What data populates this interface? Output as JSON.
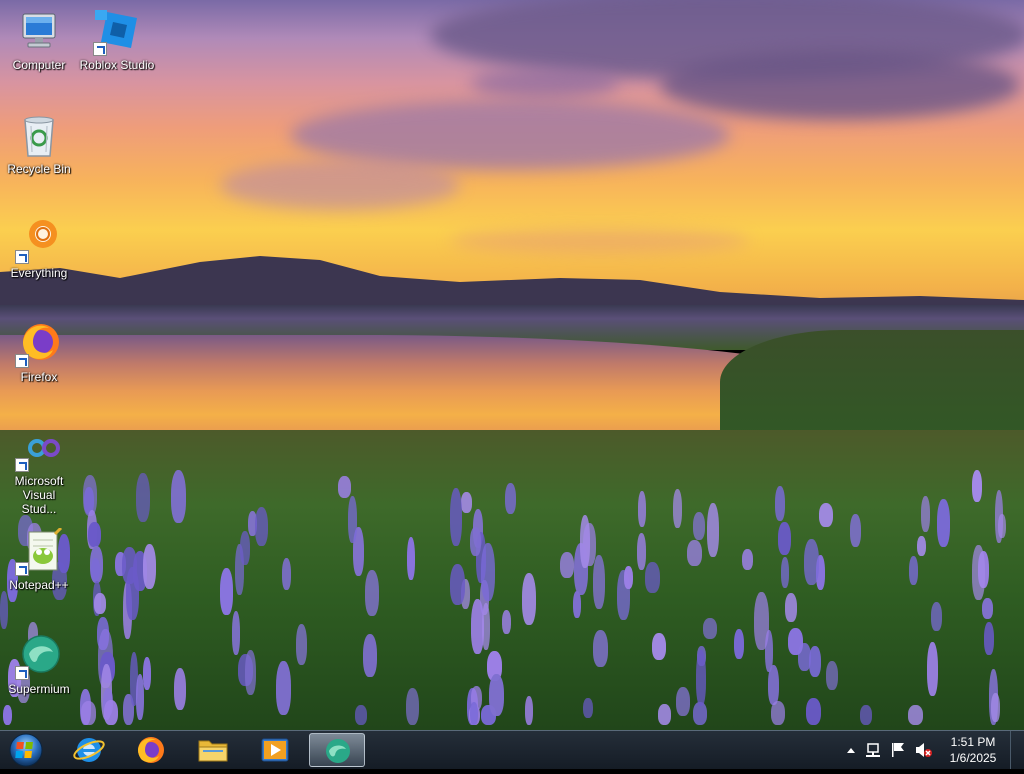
{
  "desktop": {
    "icons": [
      {
        "label": "Computer",
        "icon": "computer-icon"
      },
      {
        "label": "Roblox Studio",
        "icon": "roblox-studio-icon"
      },
      {
        "label": "Recycle Bin",
        "icon": "recycle-bin-icon"
      },
      {
        "label": "Everything",
        "icon": "everything-search-icon"
      },
      {
        "label": "Firefox",
        "icon": "firefox-icon"
      },
      {
        "label": "Microsoft Visual Stud...",
        "icon": "visual-studio-icon"
      },
      {
        "label": "Notepad++",
        "icon": "notepad-plus-plus-icon"
      },
      {
        "label": "Supermium",
        "icon": "supermium-icon"
      }
    ]
  },
  "taskbar": {
    "start_icon": "windows-start-orb",
    "pinned": [
      {
        "name": "internet-explorer",
        "icon": "internet-explorer-icon"
      },
      {
        "name": "firefox",
        "icon": "firefox-icon"
      },
      {
        "name": "file-explorer",
        "icon": "folder-icon"
      },
      {
        "name": "media-player",
        "icon": "media-player-icon"
      },
      {
        "name": "supermium",
        "icon": "supermium-icon",
        "active": true
      }
    ],
    "tray": {
      "icons": [
        "show-hidden-icons-chevron",
        "network-icon",
        "action-center-flag-icon",
        "volume-muted-icon"
      ],
      "time": "1:51 PM",
      "date": "1/6/2025"
    }
  },
  "colors": {
    "taskbar": "#1c2530",
    "label_text": "#ffffff"
  }
}
